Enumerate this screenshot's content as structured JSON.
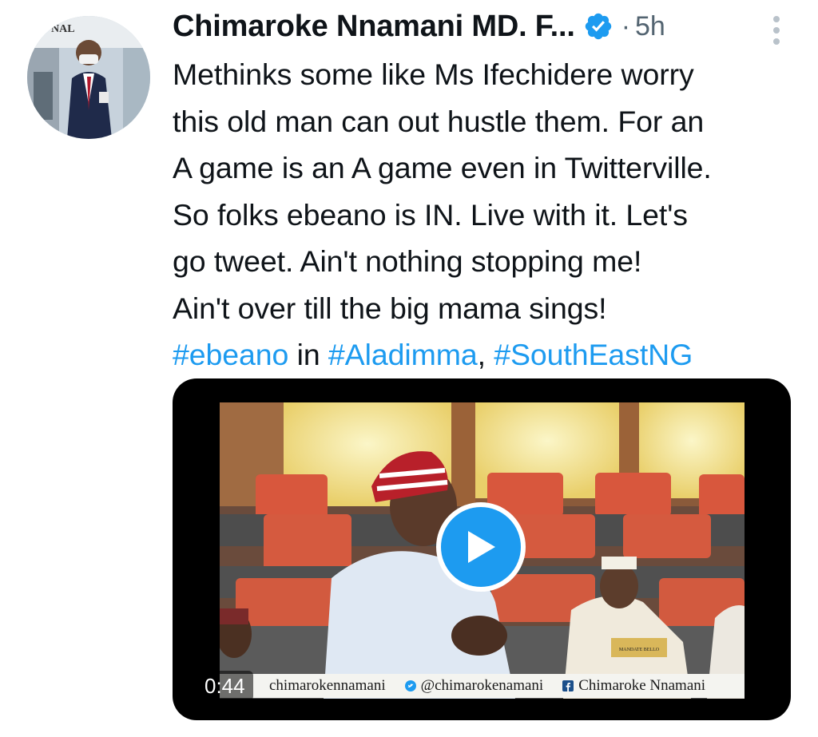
{
  "author": {
    "name": "Chimaroke Nnamani MD. F...",
    "verified": true,
    "separator": "·",
    "time": "5h",
    "avatar_sign_text": "NAL"
  },
  "tweet": {
    "lines": [
      "Methinks some like Ms Ifechidere worry",
      "this old man can out hustle them. For an",
      "A game is an A game even in Twitterville.",
      "So folks ebeano is IN. Live with it. Let's",
      "go tweet. Ain't nothing stopping me!",
      "Ain't over till the big mama sings!"
    ],
    "last_line": {
      "tag1": "#ebeano",
      "word_in": " in ",
      "tag2": "#Aladimma",
      "comma": ", ",
      "tag3": "#SouthEastNG"
    }
  },
  "media": {
    "duration": "0:44",
    "banner": {
      "handle_text": "chimarokennamani",
      "twitter_handle": "@chimarokenamani",
      "facebook_name": "Chimaroke Nnamani"
    },
    "nameplate_text": "MANDATE BELLO"
  },
  "colors": {
    "accent": "#1d9bf0",
    "text": "#0f1419",
    "secondary": "#536471"
  },
  "icons": {
    "verified": "verified-badge-icon",
    "more": "more-options-icon",
    "play": "play-icon"
  }
}
